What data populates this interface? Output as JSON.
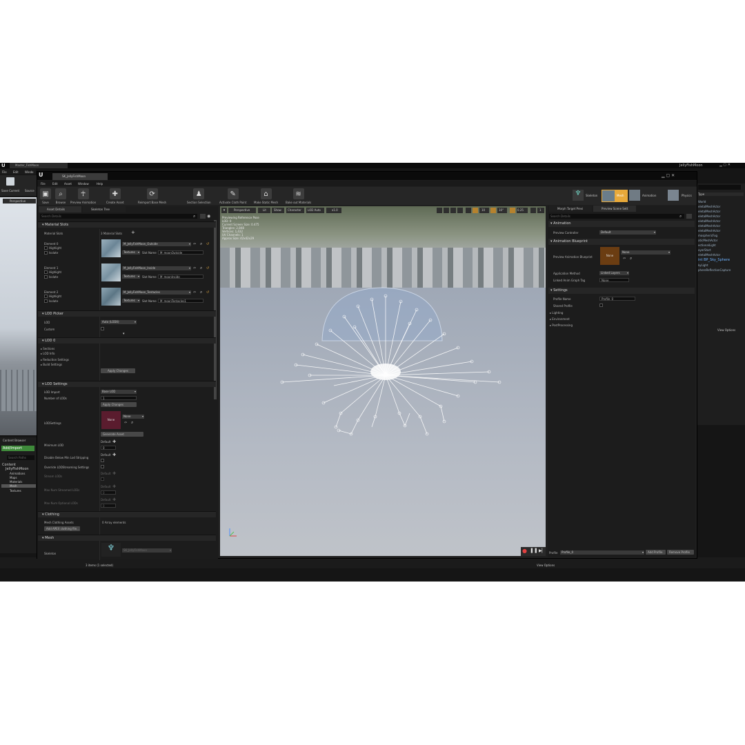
{
  "outer": {
    "tab_title": "Master_FishMoon",
    "project": "JellyFishMoon",
    "menu": [
      "File",
      "Edit",
      "Windo"
    ],
    "save_label": "Save Current",
    "source_label": "Source",
    "perspective": "Perspective",
    "content_browser": "Content Browser",
    "add_import": "Add/Import",
    "search_paths": "Search Paths",
    "tree": [
      "Content",
      "JellyFishMoon",
      "Animations",
      "Maps",
      "Materials",
      "Mesh",
      "Textures"
    ],
    "status_items": "3 items (1 selected)",
    "view_options": "View Options",
    "view_options_right": "View Options",
    "outliner_type": "Type",
    "outliner": [
      "World",
      "eletalMeshActor",
      "eletalMeshActor",
      "eletalMeshActor",
      "eletalMeshActor",
      "eletalMeshActor",
      "eletalMeshActor",
      "mosphericFog",
      "aticMeshActor",
      "ectionalLight",
      "ayerStart",
      "eletalMeshActor",
      "int BP_Sky_Sphere",
      "kyLight",
      "phereReflectionCapture"
    ]
  },
  "editor": {
    "tab": "SK_JellyFishMoon",
    "menu": [
      "File",
      "Edit",
      "Asset",
      "Window",
      "Help"
    ],
    "toolbar": [
      "Save",
      "Browse",
      "Preview Animation",
      "Create Asset",
      "Reimport Base Mesh",
      "Section Selection",
      "Activate Cloth Paint",
      "Make Static Mesh",
      "Bake out Materials"
    ],
    "modes": {
      "skeleton": "Skeleton",
      "mesh": "Mesh",
      "animation": "Animation",
      "physics": "Physics"
    }
  },
  "details": {
    "tabs": [
      "Asset Details",
      "Skeleton Tree"
    ],
    "search": "Search Details",
    "material_slots": {
      "header": "Material Slots",
      "label": "Material Slots",
      "count": "3 Material Slots",
      "elements": [
        {
          "name": "Element 0",
          "material": "M_JellyFishMoon_Outside",
          "slot": "M_moonOutside"
        },
        {
          "name": "Element 1",
          "material": "M_JellyFishMoon_Inside",
          "slot": "M_moonInside"
        },
        {
          "name": "Element 2",
          "material": "M_JellyFishMoon_Tentacles",
          "slot": "M_moonTentacles1"
        }
      ],
      "highlight": "Highlight",
      "isolate": "Isolate",
      "textures": "Textures",
      "slot_name": "Slot Name"
    },
    "lod_picker": {
      "header": "LOD Picker",
      "lod": "LOD",
      "lod_value": "Auto (LOD0)",
      "custom": "Custom"
    },
    "lod0": {
      "header": "LOD 0",
      "items": [
        "Sections",
        "LOD Info",
        "Reduction Settings",
        "Build Settings"
      ],
      "apply": "Apply Changes"
    },
    "lod_settings": {
      "header": "LOD Settings",
      "lod_import": "LOD Import",
      "lod_import_value": "Base LOD",
      "num_lods": "Number of LODs",
      "num_lods_value": "1",
      "apply": "Apply Changes",
      "lod_settings": "LODSettings",
      "none": "None",
      "generate": "Generate Asset",
      "min_lod": "Minimum LOD",
      "default": "Default",
      "min_lod_value": "0",
      "disable_below": "Disable Below Min Lod Stripping",
      "override_streaming": "Override LODStreaming Settings",
      "stream_lods": "Stream LODs",
      "max_streamed": "Max Num Streamed LODs",
      "max_optional": "Max Num Optional LODs",
      "zero": "0"
    },
    "clothing": {
      "header": "Clothing",
      "mesh_assets": "Mesh Clothing Assets",
      "count": "0 Array elements",
      "add": "Add APEX clothing file..."
    },
    "mesh": {
      "header": "Mesh",
      "skeleton": "Skeleton",
      "skeleton_value": "SK_JellyFishMoon"
    }
  },
  "viewport": {
    "perspective": "Perspective",
    "lit": "Lit",
    "show": "Show",
    "character": "Character",
    "lod": "LOD Auto",
    "speed": "x1.0",
    "stats": [
      "Previewing Reference Pose",
      "LOD: 0",
      "Current Screen Size: 0.475",
      "Triangles: 2,848",
      "Vertices: 1,432",
      "UV Channels: 1",
      "Approx Size: 42x42x29"
    ],
    "snap_values": [
      "10",
      "10°",
      "0.25",
      "1"
    ]
  },
  "right_panel": {
    "tabs": [
      "Morph Target Previ",
      "Preview Scene Sett"
    ],
    "search": "Search Details",
    "animation_header": "Animation",
    "preview_controller": "Preview Controller",
    "preview_controller_value": "Default",
    "anim_bp_header": "Animation Blueprint",
    "preview_anim_bp": "Preview Animation Blueprint",
    "none": "None",
    "none_dropdown": "None",
    "application_method": "Application Method",
    "application_value": "Linked Layers",
    "linked_tag": "Linked Anim Graph Tag",
    "linked_tag_value": "None",
    "settings_header": "Settings",
    "profile_name": "Profile Name",
    "profile_name_value": "Profile_0",
    "shared_profile": "Shared Profile",
    "lighting": "Lighting",
    "environment": "Environment",
    "postprocessing": "PostProcessing",
    "profile": "Profile",
    "profile_value": "Profile_0",
    "add_profile": "Add Profile",
    "remove_profile": "Remove Profile"
  },
  "colors": {
    "accent": "#e8a93a",
    "add_green": "#3e8a3a",
    "bg": "#151515",
    "panel": "#1f1f1f"
  }
}
